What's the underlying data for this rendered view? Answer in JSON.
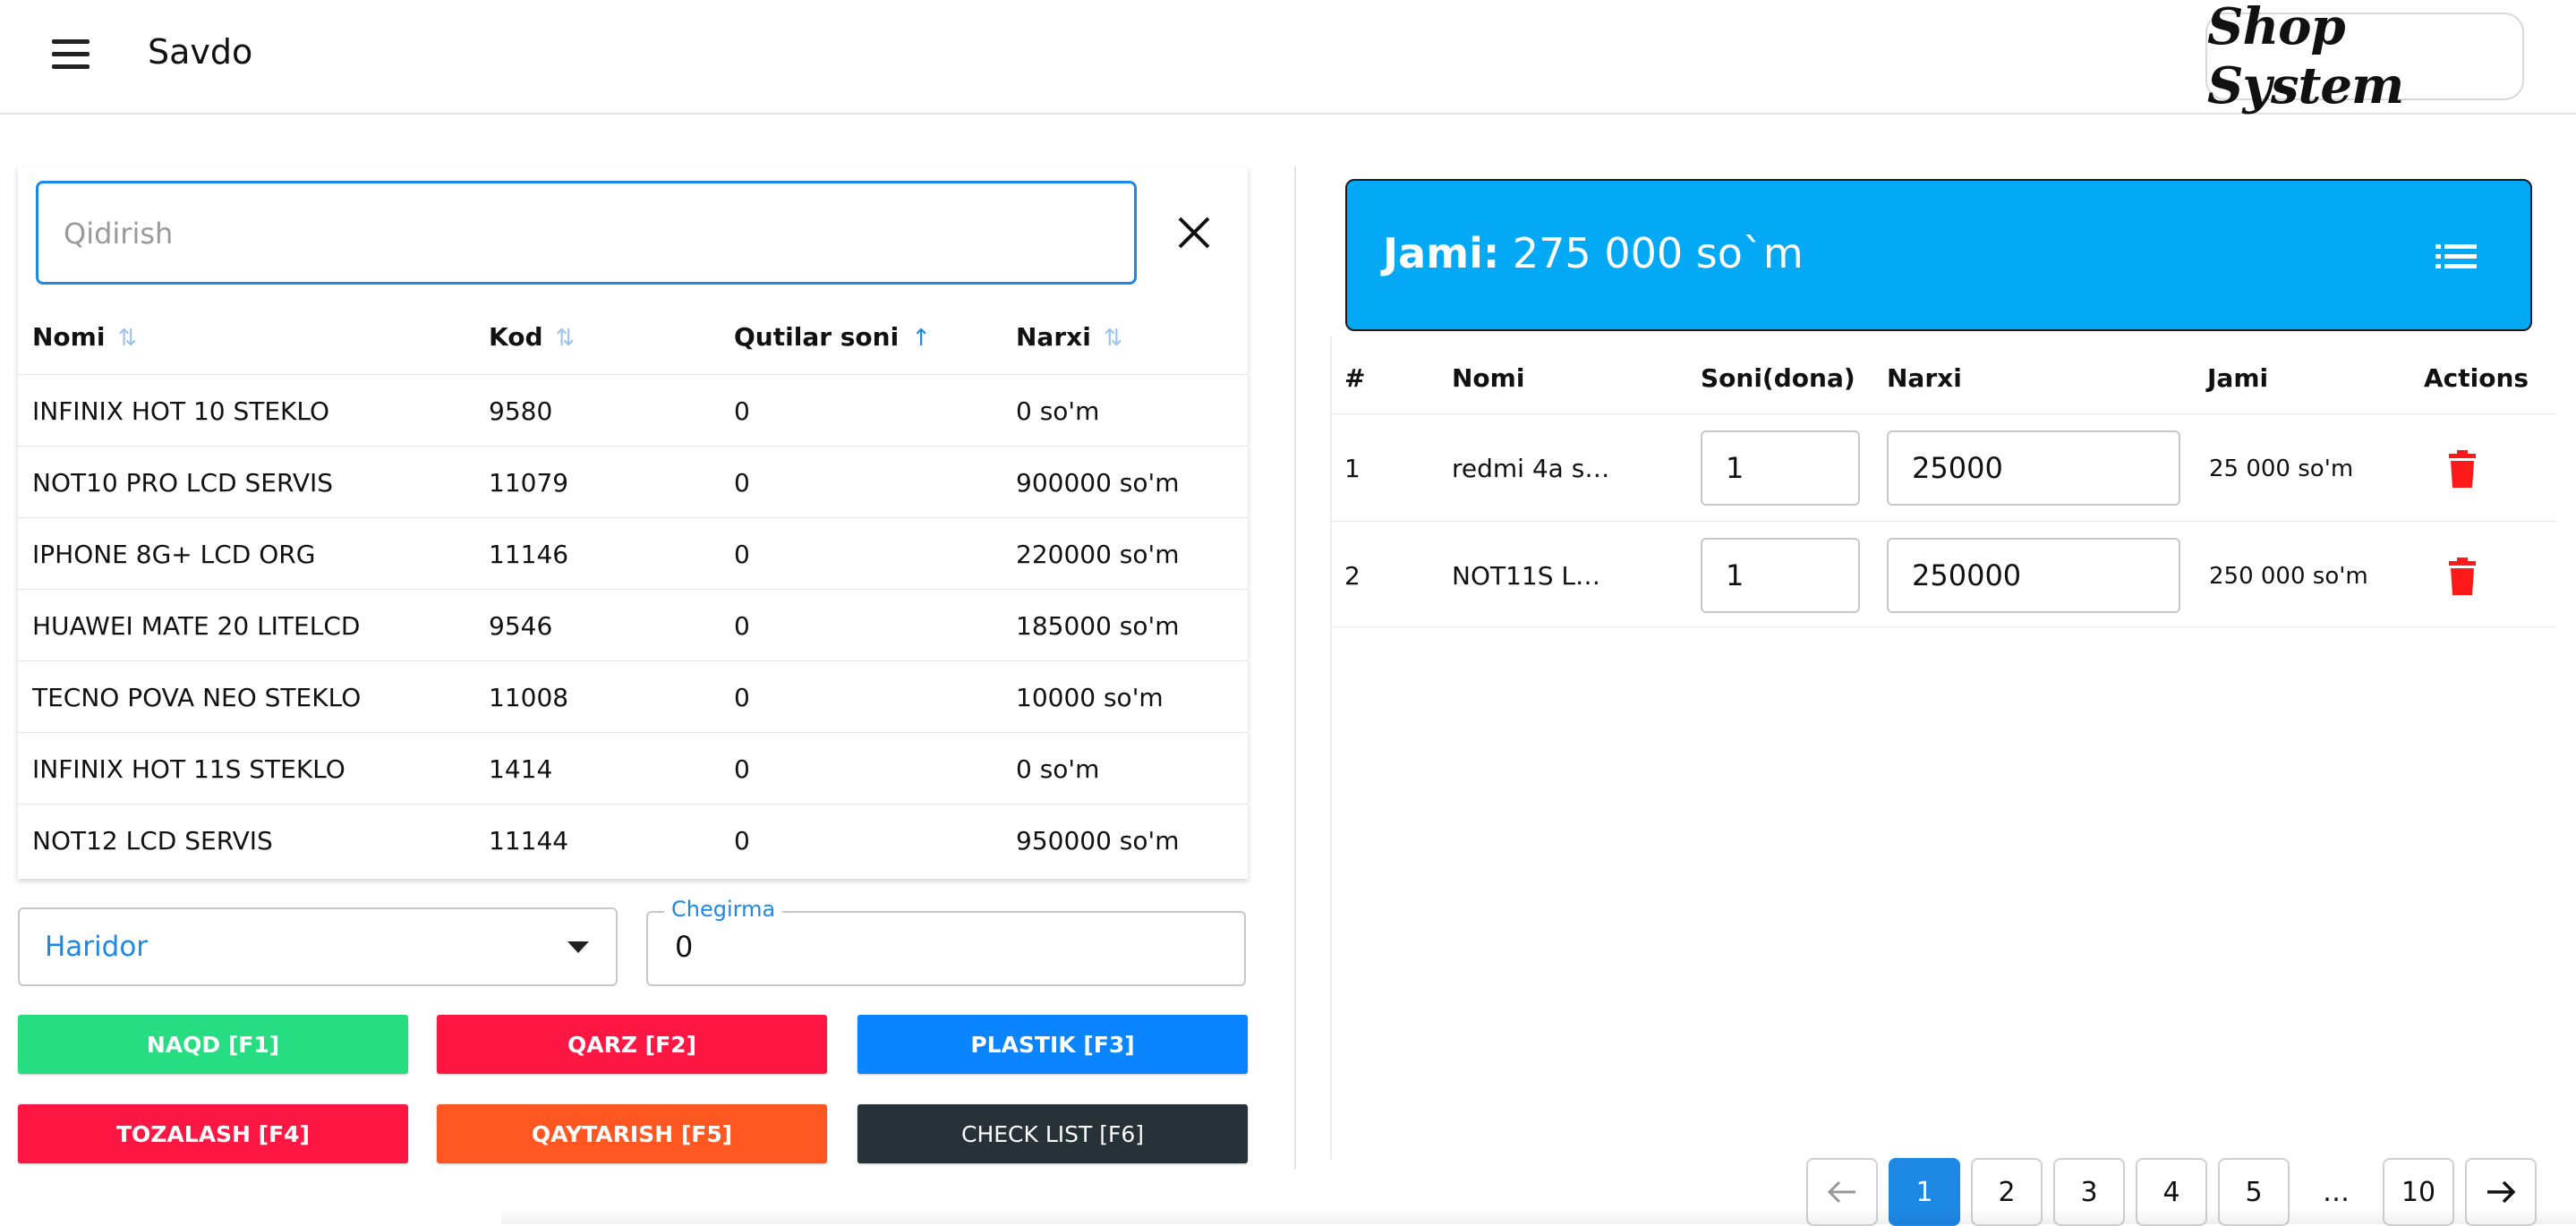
{
  "header": {
    "title": "Savdo",
    "logo_text": "Shop System"
  },
  "search": {
    "placeholder": "Qidirish"
  },
  "products": {
    "columns": [
      "Nomi",
      "Kod",
      "Qutilar soni",
      "Narxi"
    ],
    "rows": [
      {
        "name": "INFINIX HOT 10 STEKLO",
        "code": "9580",
        "boxes": "0",
        "price": "0 so'm"
      },
      {
        "name": "NOT10 PRO LCD SERVIS",
        "code": "11079",
        "boxes": "0",
        "price": "900000 so'm"
      },
      {
        "name": "IPHONE 8G+ LCD ORG",
        "code": "11146",
        "boxes": "0",
        "price": "220000 so'm"
      },
      {
        "name": "HUAWEI MATE 20 LITELCD",
        "code": "9546",
        "boxes": "0",
        "price": "185000 so'm"
      },
      {
        "name": "TECNO POVA NEO STEKLO",
        "code": "11008",
        "boxes": "0",
        "price": "10000 so'm"
      },
      {
        "name": "INFINIX HOT 11S STEKLO",
        "code": "1414",
        "boxes": "0",
        "price": "0 so'm"
      },
      {
        "name": "NOT12 LCD SERVIS",
        "code": "11144",
        "boxes": "0",
        "price": "950000 so'm"
      }
    ]
  },
  "customer_select": {
    "value": "Haridor"
  },
  "discount": {
    "label": "Chegirma",
    "value": "0"
  },
  "buttons": {
    "cash": "NAQD [F1]",
    "debt": "QARZ [F2]",
    "card": "PLASTIK [F3]",
    "clear": "TOZALASH [F4]",
    "return": "QAYTARISH [F5]",
    "checklist": "CHECK LIST [F6]"
  },
  "total": {
    "label": "Jami:",
    "value": "275 000 so`m"
  },
  "cart": {
    "columns": [
      "#",
      "Nomi",
      "Soni(dona)",
      "Narxi",
      "Jami",
      "Actions"
    ],
    "rows": [
      {
        "index": "1",
        "name": "redmi 4a s…",
        "qty": "1",
        "price": "25000",
        "total": "25 000 so'm"
      },
      {
        "index": "2",
        "name": "NOT11S L…",
        "qty": "1",
        "price": "250000",
        "total": "250 000 so'm"
      }
    ]
  },
  "pagination": {
    "pages": [
      "1",
      "2",
      "3",
      "4",
      "5",
      "…",
      "10"
    ],
    "current": "1"
  },
  "colors": {
    "accent": "#1e88e5",
    "total_bg": "#03a9f4",
    "cash": "#26de81",
    "debt": "#ff1744",
    "card": "#0a84ff",
    "clear": "#ff1744",
    "return": "#ff5722",
    "checklist": "#263238",
    "delete": "#ff1a1a"
  }
}
